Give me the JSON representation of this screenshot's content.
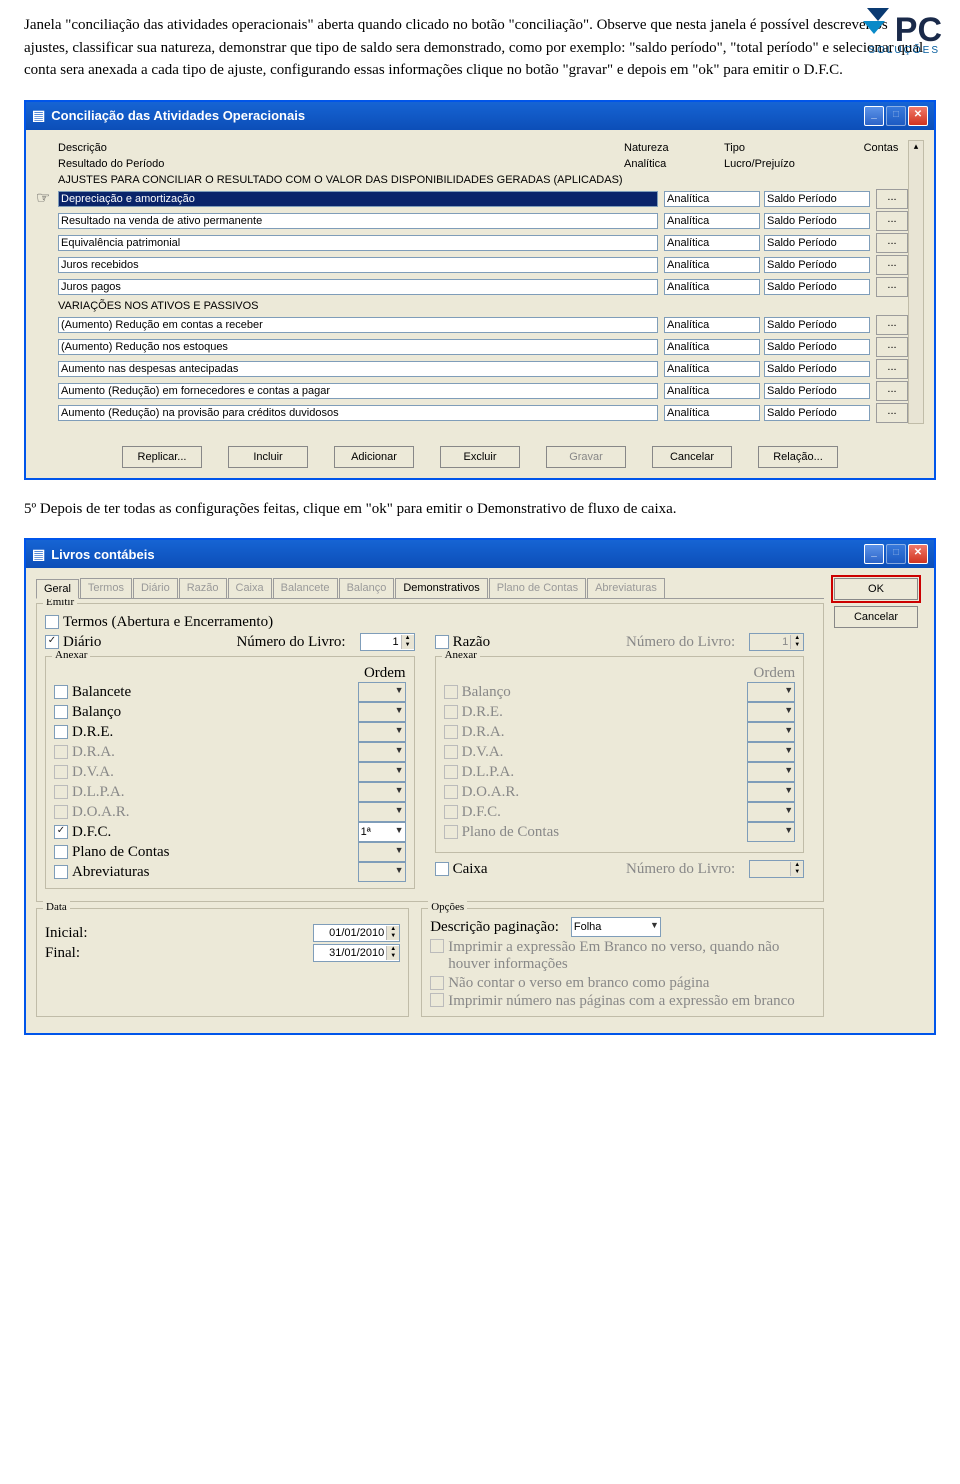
{
  "logo": {
    "brand": "PC",
    "sub": "SOLUÇÕES"
  },
  "text1": "Janela \"conciliação das atividades operacionais\" aberta quando clicado no botão \"conciliação\". Observe que nesta janela é possível descrever os ajustes, classificar sua natureza, demonstrar que tipo de saldo sera demonstrado, como por exemplo: \"saldo período\", \"total período\" e selecionar qual conta sera anexada a cada tipo de ajuste, configurando essas informações clique no botão \"gravar\" e depois em \"ok\" para emitir o D.F.C.",
  "text2": "5º Depois de ter todas as configurações feitas, clique em \"ok\" para emitir o Demonstrativo de fluxo de caixa.",
  "window1": {
    "title": "Conciliação das Atividades Operacionais",
    "headers": {
      "desc": "Descrição",
      "nat": "Natureza",
      "tipo": "Tipo",
      "contas": "Contas"
    },
    "resultado": {
      "desc": "Resultado do Período",
      "nat": "Analítica",
      "tipo": "Lucro/Prejuízo"
    },
    "section1": "AJUSTES PARA CONCILIAR O RESULTADO COM O VALOR DAS DISPONIBILIDADES GERADAS (APLICADAS)",
    "rows1": [
      {
        "desc": "Depreciação e amortização",
        "nat": "Analítica",
        "tipo": "Saldo Período",
        "selected": true
      },
      {
        "desc": "Resultado na venda de ativo permanente",
        "nat": "Analítica",
        "tipo": "Saldo Período"
      },
      {
        "desc": "Equivalência patrimonial",
        "nat": "Analítica",
        "tipo": "Saldo Período"
      },
      {
        "desc": "Juros recebidos",
        "nat": "Analítica",
        "tipo": "Saldo Período"
      },
      {
        "desc": "Juros pagos",
        "nat": "Analítica",
        "tipo": "Saldo Período"
      }
    ],
    "section2": "VARIAÇÕES NOS ATIVOS E PASSIVOS",
    "rows2": [
      {
        "desc": "(Aumento) Redução em contas a receber",
        "nat": "Analítica",
        "tipo": "Saldo Período"
      },
      {
        "desc": "(Aumento) Redução nos estoques",
        "nat": "Analítica",
        "tipo": "Saldo Período"
      },
      {
        "desc": "Aumento nas despesas antecipadas",
        "nat": "Analítica",
        "tipo": "Saldo Período"
      },
      {
        "desc": "Aumento (Redução) em fornecedores e contas a pagar",
        "nat": "Analítica",
        "tipo": "Saldo Período"
      },
      {
        "desc": "Aumento (Redução) na provisão para créditos duvidosos",
        "nat": "Analítica",
        "tipo": "Saldo Período"
      }
    ],
    "buttons": {
      "replicar": "Replicar...",
      "incluir": "Incluir",
      "adicionar": "Adicionar",
      "excluir": "Excluir",
      "gravar": "Gravar",
      "cancelar": "Cancelar",
      "relacao": "Relação..."
    }
  },
  "window2": {
    "title": "Livros contábeis",
    "tabs": [
      "Geral",
      "Termos",
      "Diário",
      "Razão",
      "Caixa",
      "Balancete",
      "Balanço",
      "Demonstrativos",
      "Plano de Contas",
      "Abreviaturas"
    ],
    "activeTab": 0,
    "ok": "OK",
    "cancelar": "Cancelar",
    "emitir": {
      "legend": "Emitir",
      "termos": "Termos (Abertura e Encerramento)",
      "diario": "Diário",
      "razao": "Razão",
      "numero_label": "Número do Livro:",
      "numero1": "1",
      "numero2": "1",
      "anexar": "Anexar",
      "ordem": "Ordem",
      "leftItems": [
        {
          "label": "Balancete",
          "enabled": true,
          "checked": false
        },
        {
          "label": "Balanço",
          "enabled": true,
          "checked": false
        },
        {
          "label": "D.R.E.",
          "enabled": true,
          "checked": false
        },
        {
          "label": "D.R.A.",
          "enabled": false,
          "checked": false
        },
        {
          "label": "D.V.A.",
          "enabled": false,
          "checked": false
        },
        {
          "label": "D.L.P.A.",
          "enabled": false,
          "checked": false
        },
        {
          "label": "D.O.A.R.",
          "enabled": false,
          "checked": false
        },
        {
          "label": "D.F.C.",
          "enabled": true,
          "checked": true,
          "ordem": "1ª"
        },
        {
          "label": "Plano de Contas",
          "enabled": true,
          "checked": false
        },
        {
          "label": "Abreviaturas",
          "enabled": true,
          "checked": false
        }
      ],
      "rightItems": [
        {
          "label": "Balanço",
          "enabled": false
        },
        {
          "label": "D.R.E.",
          "enabled": false
        },
        {
          "label": "D.R.A.",
          "enabled": false
        },
        {
          "label": "D.V.A.",
          "enabled": false
        },
        {
          "label": "D.L.P.A.",
          "enabled": false
        },
        {
          "label": "D.O.A.R.",
          "enabled": false
        },
        {
          "label": "D.F.C.",
          "enabled": false
        },
        {
          "label": "Plano de Contas",
          "enabled": false
        }
      ],
      "caixa": "Caixa"
    },
    "data": {
      "legend": "Data",
      "inicialLabel": "Inicial:",
      "finalLabel": "Final:",
      "inicial": "01/01/2010",
      "final": "31/01/2010"
    },
    "opcoes": {
      "legend": "Opções",
      "descPagLabel": "Descrição paginação:",
      "descPagValue": "Folha",
      "opt1": "Imprimir a expressão Em Branco no verso, quando não houver informações",
      "opt2": "Não contar o verso em branco como página",
      "opt3": "Imprimir número nas páginas com a expressão em branco"
    }
  }
}
